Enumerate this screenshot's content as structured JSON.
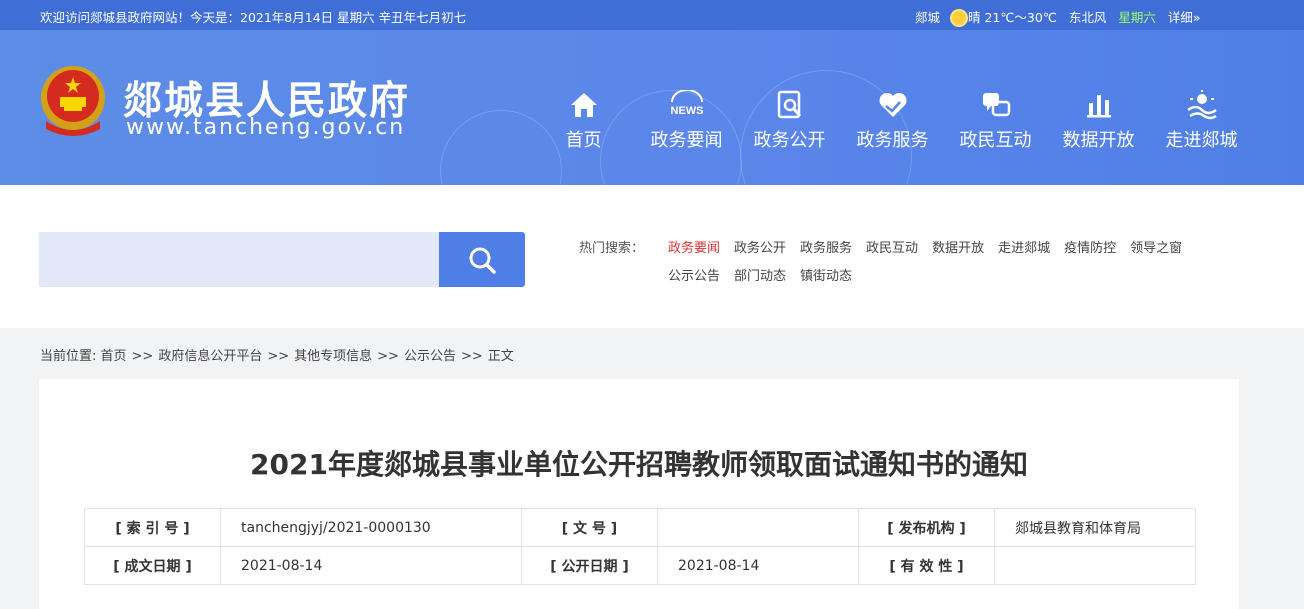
{
  "topbar": {
    "welcome": "欢迎访问郯城县政府网站！今天是：2021年8月14日  星期六  辛丑年七月初七",
    "city": "郯城",
    "weather": "晴 21℃～30℃",
    "wind": "东北风",
    "weekday": "星期六",
    "detail": "详细»"
  },
  "header": {
    "site_name": "郯城县人民政府",
    "site_url": "www.tancheng.gov.cn"
  },
  "nav": [
    {
      "label": "首页",
      "icon": "home-icon"
    },
    {
      "label": "政务要闻",
      "icon": "news-icon"
    },
    {
      "label": "政务公开",
      "icon": "document-search-icon"
    },
    {
      "label": "政务服务",
      "icon": "heart-hands-icon"
    },
    {
      "label": "政民互动",
      "icon": "chat-icon"
    },
    {
      "label": "数据开放",
      "icon": "bar-chart-icon"
    },
    {
      "label": "走进郯城",
      "icon": "landscape-icon"
    }
  ],
  "search": {
    "placeholder": "",
    "hot_label": "热门搜索：",
    "hot_terms": [
      "政务要闻",
      "政务公开",
      "政务服务",
      "政民互动",
      "数据开放",
      "走进郯城",
      "疫情防控",
      "领导之窗",
      "公示公告",
      "部门动态",
      "镇街动态"
    ]
  },
  "breadcrumb": {
    "prefix": "当前位置: ",
    "items": [
      "首页",
      "政府信息公开平台",
      "其他专项信息",
      "公示公告",
      "正文"
    ],
    "separator": ">>"
  },
  "article": {
    "title": "2021年度郯城县事业单位公开招聘教师领取面试通知书的通知",
    "meta": {
      "index_label": "[ 索  引  号 ]",
      "index_value": "tanchengjyj/2021-0000130",
      "docno_label": "[ 文      号 ]",
      "docno_value": "",
      "publisher_label": "[ 发布机构 ]",
      "publisher_value": "郯城县教育和体育局",
      "created_label": "[ 成文日期 ]",
      "created_value": "2021-08-14",
      "published_label": "[ 公开日期 ]",
      "published_value": "2021-08-14",
      "validity_label": "[ 有  效  性 ]",
      "validity_value": ""
    }
  },
  "colors": {
    "topbar": "#3f6fd6",
    "banner": "#5b86ea",
    "accent": "#4e7ee6",
    "hot_active": "#d33333"
  }
}
